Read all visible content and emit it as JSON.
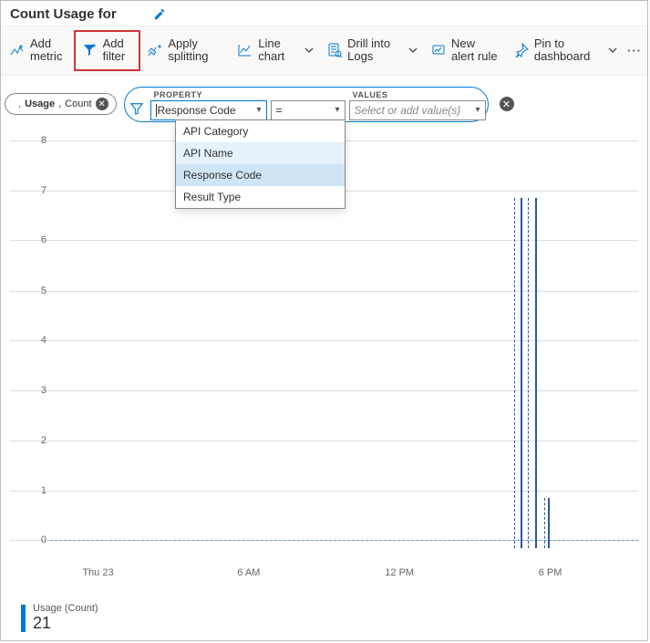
{
  "header": {
    "title": "Count Usage for"
  },
  "toolbar": {
    "add_metric": "Add metric",
    "add_filter": "Add filter",
    "apply_splitting": "Apply splitting",
    "line_chart": "Line chart",
    "drill_logs": "Drill into Logs",
    "new_alert": "New alert rule",
    "pin": "Pin to dashboard"
  },
  "chip": {
    "metric": "Usage",
    "agg": "Count"
  },
  "filter": {
    "prop_label": "Property",
    "prop_value": "Response Code",
    "op_value": "=",
    "values_label": "Values",
    "values_placeholder": "Select or add value(s)",
    "options": [
      "API Category",
      "API Name",
      "Response Code",
      "Result Type"
    ]
  },
  "chart_data": {
    "type": "line",
    "title": "",
    "xlabel": "",
    "ylabel": "",
    "ylim": [
      0,
      8.5
    ],
    "yticks": [
      0,
      1,
      2,
      3,
      4,
      5,
      6,
      7,
      8
    ],
    "xticks": [
      "Thu 23",
      "6 AM",
      "12 PM",
      "6 PM"
    ],
    "series": [
      {
        "name": "Usage (Count)",
        "approx_peaks_y": [
          7,
          7,
          1
        ],
        "baseline_y": 0
      }
    ]
  },
  "legend": {
    "label": "Usage (Count)",
    "value": "21"
  }
}
